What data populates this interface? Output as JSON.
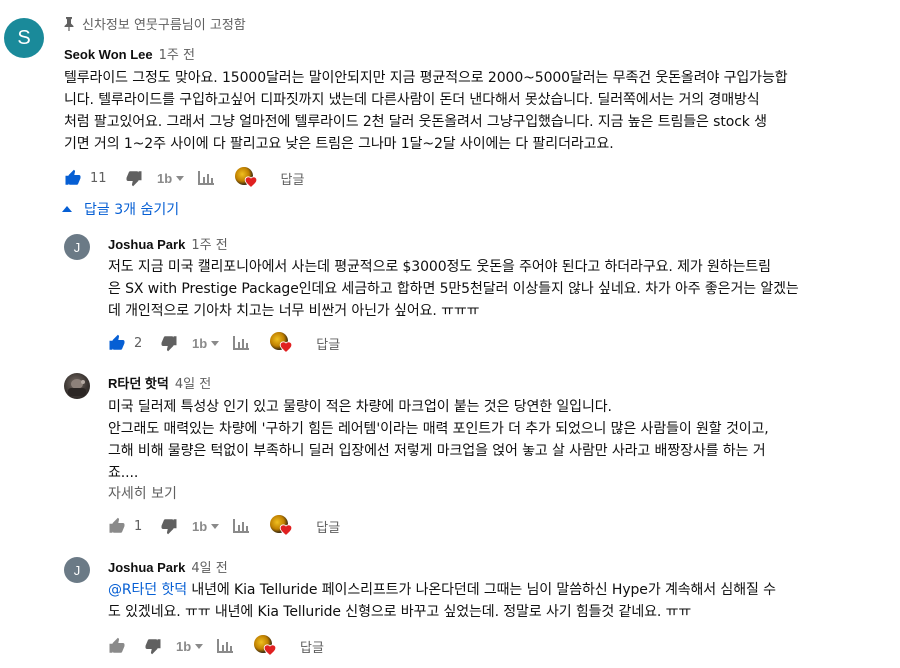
{
  "colors": {
    "link": "#065fd4",
    "meta": "#606060",
    "text": "#0f0f0f",
    "heart": "#e02020"
  },
  "comment": {
    "avatar_letter": "S",
    "pinned_label": "신차정보 연뭇구름님이 고정함",
    "author": "Seok Won Lee",
    "time": "1주 전",
    "lines": [
      "텔루라이드 그정도 맞아요. 15000달러는 말이안되지만 지금 평균적으로 2000~5000달러는 무족건 웃돈올려야 구입가능합",
      "니다. 텔루라이드를 구입하고싶어 디파짓까지 냈는데 다른사람이 돈더 낸다해서 못샀습니다. 딜러쪽에서는 거의 경매방식",
      "처럼 팔고있어요. 그래서 그냥 얼마전에 텔루라이드 2천 달러 웃돈올려서 그냥구입했습니다. 지금 높은 트림들은 stock 생",
      "기면 거의 1~2주 사이에 다 팔리고요 낮은 트림은 그나마 1달~2달 사이에는 다 팔리더라고요."
    ],
    "likes": "11",
    "reply_label": "답글"
  },
  "replies_toggle": "답글 3개 숨기기",
  "replies": [
    {
      "avatar_letter": "J",
      "author": "Joshua Park",
      "time": "1주 전",
      "lines": [
        "저도 지금 미국 캘리포니아에서 사는데 평균적으로 $3000정도 웃돈을 주어야 된다고 하더라구요. 제가 원하는트림",
        "은 SX with Prestige Package인데요 세금하고 합하면 5만5천달러 이상들지 않나 싶네요. 차가 아주 좋은거는 알겠는",
        "데 개인적으로 기아차 치고는 너무 비싼거 아닌가 싶어요. ㅠㅠㅠ"
      ],
      "likes": "2",
      "reply_label": "답글"
    },
    {
      "author": "R타던 핫덕",
      "time": "4일 전",
      "lines": [
        "미국 딜러제 특성상 인기 있고 물량이 적은 차량에 마크업이 붙는 것은 당연한 일입니다.",
        "안그래도 매력있는 차량에 '구하기 힘든 레어템'이라는 매력 포인트가 더 추가 되었으니 많은 사람들이 원할 것이고,",
        "그해 비해 물량은 턱없이 부족하니 딜러 입장에선 저렇게 마크업을 얹어 놓고 살 사람만 사라고 배짱장사를 하는 거",
        "죠...."
      ],
      "read_more": "자세히 보기",
      "likes": "1",
      "reply_label": "답글"
    },
    {
      "avatar_letter": "J",
      "author": "Joshua Park",
      "time": "4일 전",
      "mention": "@R타던 핫덕",
      "line1_rest": "  내년에 Kia Telluride 페이스리프트가 나온다던데 그때는 님이 말씀하신 Hype가 계속해서 심해질 수",
      "line2": "도 있겠네요. ㅠㅠ 내년에 Kia Telluride 신형으로 바꾸고 싶었는데. 정말로 사기 힘들것 같네요. ㅠㅠ",
      "likes": "",
      "reply_label": "답글"
    }
  ]
}
